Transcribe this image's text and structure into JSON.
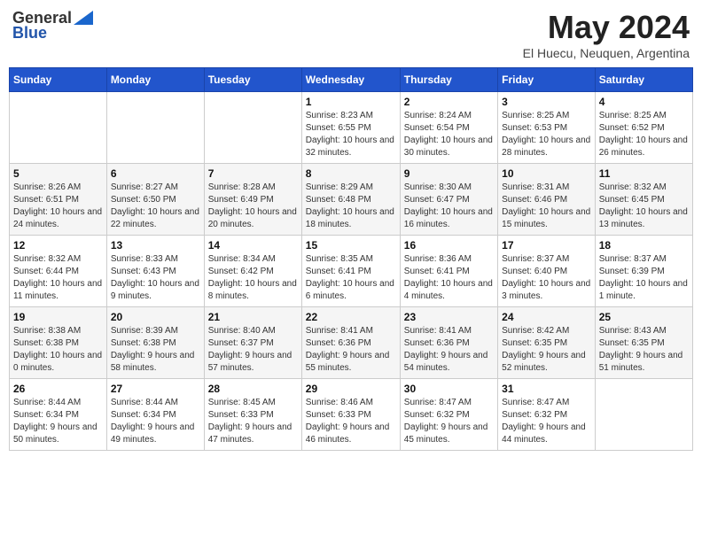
{
  "logo": {
    "general": "General",
    "blue": "Blue"
  },
  "title": "May 2024",
  "subtitle": "El Huecu, Neuquen, Argentina",
  "days_of_week": [
    "Sunday",
    "Monday",
    "Tuesday",
    "Wednesday",
    "Thursday",
    "Friday",
    "Saturday"
  ],
  "weeks": [
    [
      {
        "day": "",
        "info": ""
      },
      {
        "day": "",
        "info": ""
      },
      {
        "day": "",
        "info": ""
      },
      {
        "day": "1",
        "info": "Sunrise: 8:23 AM\nSunset: 6:55 PM\nDaylight: 10 hours and 32 minutes."
      },
      {
        "day": "2",
        "info": "Sunrise: 8:24 AM\nSunset: 6:54 PM\nDaylight: 10 hours and 30 minutes."
      },
      {
        "day": "3",
        "info": "Sunrise: 8:25 AM\nSunset: 6:53 PM\nDaylight: 10 hours and 28 minutes."
      },
      {
        "day": "4",
        "info": "Sunrise: 8:25 AM\nSunset: 6:52 PM\nDaylight: 10 hours and 26 minutes."
      }
    ],
    [
      {
        "day": "5",
        "info": "Sunrise: 8:26 AM\nSunset: 6:51 PM\nDaylight: 10 hours and 24 minutes."
      },
      {
        "day": "6",
        "info": "Sunrise: 8:27 AM\nSunset: 6:50 PM\nDaylight: 10 hours and 22 minutes."
      },
      {
        "day": "7",
        "info": "Sunrise: 8:28 AM\nSunset: 6:49 PM\nDaylight: 10 hours and 20 minutes."
      },
      {
        "day": "8",
        "info": "Sunrise: 8:29 AM\nSunset: 6:48 PM\nDaylight: 10 hours and 18 minutes."
      },
      {
        "day": "9",
        "info": "Sunrise: 8:30 AM\nSunset: 6:47 PM\nDaylight: 10 hours and 16 minutes."
      },
      {
        "day": "10",
        "info": "Sunrise: 8:31 AM\nSunset: 6:46 PM\nDaylight: 10 hours and 15 minutes."
      },
      {
        "day": "11",
        "info": "Sunrise: 8:32 AM\nSunset: 6:45 PM\nDaylight: 10 hours and 13 minutes."
      }
    ],
    [
      {
        "day": "12",
        "info": "Sunrise: 8:32 AM\nSunset: 6:44 PM\nDaylight: 10 hours and 11 minutes."
      },
      {
        "day": "13",
        "info": "Sunrise: 8:33 AM\nSunset: 6:43 PM\nDaylight: 10 hours and 9 minutes."
      },
      {
        "day": "14",
        "info": "Sunrise: 8:34 AM\nSunset: 6:42 PM\nDaylight: 10 hours and 8 minutes."
      },
      {
        "day": "15",
        "info": "Sunrise: 8:35 AM\nSunset: 6:41 PM\nDaylight: 10 hours and 6 minutes."
      },
      {
        "day": "16",
        "info": "Sunrise: 8:36 AM\nSunset: 6:41 PM\nDaylight: 10 hours and 4 minutes."
      },
      {
        "day": "17",
        "info": "Sunrise: 8:37 AM\nSunset: 6:40 PM\nDaylight: 10 hours and 3 minutes."
      },
      {
        "day": "18",
        "info": "Sunrise: 8:37 AM\nSunset: 6:39 PM\nDaylight: 10 hours and 1 minute."
      }
    ],
    [
      {
        "day": "19",
        "info": "Sunrise: 8:38 AM\nSunset: 6:38 PM\nDaylight: 10 hours and 0 minutes."
      },
      {
        "day": "20",
        "info": "Sunrise: 8:39 AM\nSunset: 6:38 PM\nDaylight: 9 hours and 58 minutes."
      },
      {
        "day": "21",
        "info": "Sunrise: 8:40 AM\nSunset: 6:37 PM\nDaylight: 9 hours and 57 minutes."
      },
      {
        "day": "22",
        "info": "Sunrise: 8:41 AM\nSunset: 6:36 PM\nDaylight: 9 hours and 55 minutes."
      },
      {
        "day": "23",
        "info": "Sunrise: 8:41 AM\nSunset: 6:36 PM\nDaylight: 9 hours and 54 minutes."
      },
      {
        "day": "24",
        "info": "Sunrise: 8:42 AM\nSunset: 6:35 PM\nDaylight: 9 hours and 52 minutes."
      },
      {
        "day": "25",
        "info": "Sunrise: 8:43 AM\nSunset: 6:35 PM\nDaylight: 9 hours and 51 minutes."
      }
    ],
    [
      {
        "day": "26",
        "info": "Sunrise: 8:44 AM\nSunset: 6:34 PM\nDaylight: 9 hours and 50 minutes."
      },
      {
        "day": "27",
        "info": "Sunrise: 8:44 AM\nSunset: 6:34 PM\nDaylight: 9 hours and 49 minutes."
      },
      {
        "day": "28",
        "info": "Sunrise: 8:45 AM\nSunset: 6:33 PM\nDaylight: 9 hours and 47 minutes."
      },
      {
        "day": "29",
        "info": "Sunrise: 8:46 AM\nSunset: 6:33 PM\nDaylight: 9 hours and 46 minutes."
      },
      {
        "day": "30",
        "info": "Sunrise: 8:47 AM\nSunset: 6:32 PM\nDaylight: 9 hours and 45 minutes."
      },
      {
        "day": "31",
        "info": "Sunrise: 8:47 AM\nSunset: 6:32 PM\nDaylight: 9 hours and 44 minutes."
      },
      {
        "day": "",
        "info": ""
      }
    ]
  ]
}
